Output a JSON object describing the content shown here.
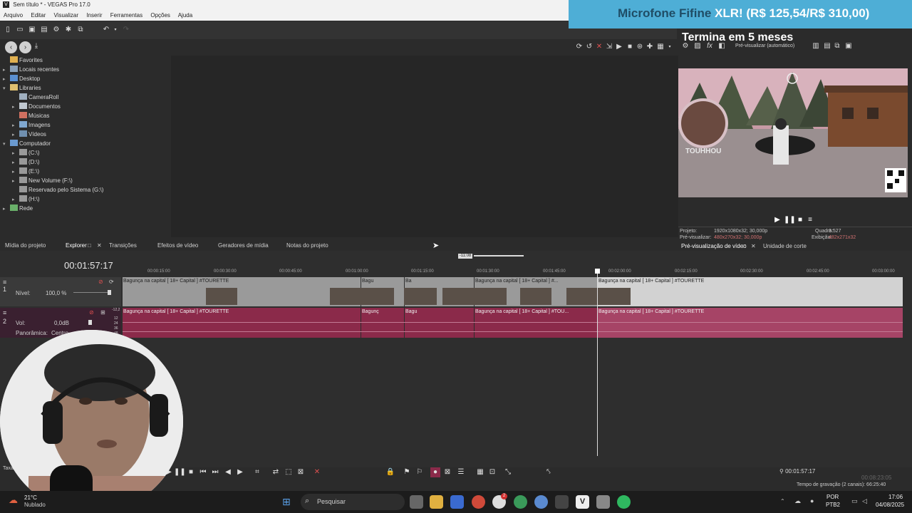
{
  "window": {
    "title": "Sem título * - VEGAS Pro 17.0",
    "app_icon": "V"
  },
  "menu": [
    "Arquivo",
    "Editar",
    "Visualizar",
    "Inserir",
    "Ferramentas",
    "Opções",
    "Ajuda"
  ],
  "overlay": {
    "promo_prefix": "Microfone Fifine",
    "promo_highlight": " XLR! (R$ 125,54/R$ 310,00)",
    "countdown": "Termina em 5 meses"
  },
  "explorer": {
    "tree": [
      {
        "label": "Favorites",
        "indent": 0,
        "arrow": ""
      },
      {
        "label": "Locais recentes",
        "indent": 0,
        "arrow": "▸"
      },
      {
        "label": "Desktop",
        "indent": 0,
        "arrow": "▸"
      },
      {
        "label": "Libraries",
        "indent": 0,
        "arrow": "▾"
      },
      {
        "label": "CameraRoll",
        "indent": 1,
        "arrow": ""
      },
      {
        "label": "Documentos",
        "indent": 1,
        "arrow": "▸"
      },
      {
        "label": "Músicas",
        "indent": 1,
        "arrow": ""
      },
      {
        "label": "Imagens",
        "indent": 1,
        "arrow": "▸"
      },
      {
        "label": "Vídeos",
        "indent": 1,
        "arrow": "▸"
      },
      {
        "label": "Computador",
        "indent": 0,
        "arrow": "▾"
      },
      {
        "label": "(C:\\)",
        "indent": 1,
        "arrow": "▸"
      },
      {
        "label": "(D:\\)",
        "indent": 1,
        "arrow": "▸"
      },
      {
        "label": "(E:\\)",
        "indent": 1,
        "arrow": "▸"
      },
      {
        "label": "New Volume (F:\\)",
        "indent": 1,
        "arrow": "▸"
      },
      {
        "label": "Reservado pelo Sistema (G:\\)",
        "indent": 1,
        "arrow": ""
      },
      {
        "label": "(H:\\)",
        "indent": 1,
        "arrow": "▸"
      },
      {
        "label": "Rede",
        "indent": 0,
        "arrow": "▸"
      }
    ],
    "tabs": [
      "Mídia do projeto",
      "Explorer",
      "Transições",
      "Efeitos de vídeo",
      "Geradores de mídia",
      "Notas do projeto"
    ]
  },
  "preview": {
    "mode": "Pré-visualizar (automático)",
    "overlay_name": "TOUHHOU",
    "info": {
      "projeto_label": "Projeto:",
      "projeto_value": "1920x1080x32; 30,000p",
      "previsualizar_label": "Pré-visualizar:",
      "previsualizar_value": "480x270x32; 30,000p",
      "quadro_label": "Quadro:",
      "quadro_value": "3.527",
      "exibicao_label": "Exibição:",
      "exibicao_value": "482x271x32"
    },
    "tabs": [
      "Pré-visualização de vídeo",
      "Unidade de corte"
    ]
  },
  "timeline": {
    "timecode": "00:01:57:17",
    "zoom_label": "-11:08",
    "ruler": [
      "00:00:15:00",
      "00:00:30:00",
      "00:00:45:00",
      "00:01:00:00",
      "00:01:15:00",
      "00:01:30:00",
      "00:01:45:00",
      "00:02:00:00",
      "00:02:15:00",
      "00:02:30:00",
      "00:02:45:00",
      "00:03:00:00"
    ],
    "video_track": {
      "number": "1",
      "level_label": "Nível:",
      "level_value": "100,0 %"
    },
    "audio_track": {
      "number": "2",
      "vol_label": "Vol:",
      "vol_value": "0,0dB",
      "pan_label": "Panorâmica:",
      "pan_value": "Centro",
      "meter": [
        "-12,2",
        "12",
        "24",
        "36",
        "48"
      ]
    },
    "clips": [
      {
        "label": "Bagunça na capital   [ 18+ Capital ] #TOURETTE"
      },
      {
        "label": "Bagu"
      },
      {
        "label": "Ba"
      },
      {
        "label": "Bagunça na capital   [ 18+ Capital ] #..."
      },
      {
        "label": "Bagunça na capital   [ 18+ Capital ] #TOURETTE"
      }
    ],
    "audio_clips": [
      {
        "label": "Bagunça na capital   [ 18+ Capital ] #TOURETTE"
      },
      {
        "label": "Bagunç"
      },
      {
        "label": "Bagu"
      },
      {
        "label": "Bagunça na capital   [ 18+ Capital ] #TOU..."
      },
      {
        "label": "Bagunça na capital   [ 18+ Capital ] #TOURETTE"
      }
    ]
  },
  "status": {
    "taxa_label": "Taxa:",
    "cursor_time": "00:01:57:17",
    "end_time": "00:08:23:05",
    "recording": "Tempo de gravação (2 canais): 66:25:40"
  },
  "taskbar": {
    "weather_temp": "21°C",
    "weather_desc": "Nublado",
    "search_placeholder": "Pesquisar",
    "lang": "POR",
    "layout": "PTB2",
    "time": "17:06",
    "date": "04/08/2025",
    "badge": "2"
  }
}
